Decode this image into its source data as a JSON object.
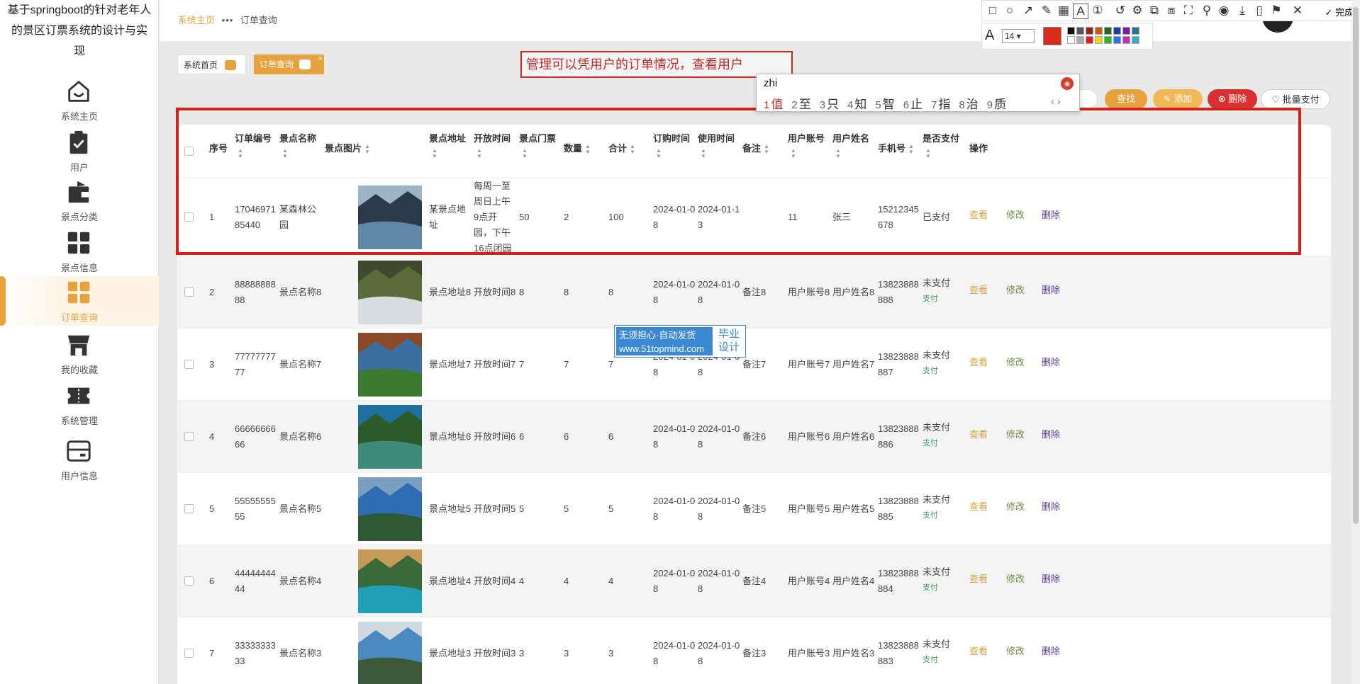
{
  "app_title": "基于springboot的针对老年人的景区订票系统的设计与实现",
  "nav": [
    {
      "label": "系统主页",
      "icon": "home-icon"
    },
    {
      "label": "用户",
      "icon": "clipboard-check-icon"
    },
    {
      "label": "景点分类",
      "icon": "wallet-icon"
    },
    {
      "label": "景点信息",
      "icon": "grid-icon"
    },
    {
      "label": "订单查询",
      "icon": "grid-icon",
      "active": true
    },
    {
      "label": "我的收藏",
      "icon": "store-icon"
    },
    {
      "label": "系统管理",
      "icon": "ticket-icon"
    },
    {
      "label": "用户信息",
      "icon": "card-icon"
    }
  ],
  "breadcrumb": {
    "home": "系统主页",
    "sep": "•••",
    "current": "订单查询"
  },
  "tabs": [
    {
      "label": "系统首页"
    },
    {
      "label": "订单查询",
      "close": "×"
    }
  ],
  "annotation": {
    "text": "管理可以凭用户的订单情况，查看用户"
  },
  "ime": {
    "composition": "zhi",
    "candidates": [
      {
        "n": "1",
        "c": "值"
      },
      {
        "n": "2",
        "c": "至"
      },
      {
        "n": "3",
        "c": "只"
      },
      {
        "n": "4",
        "c": "知"
      },
      {
        "n": "5",
        "c": "智"
      },
      {
        "n": "6",
        "c": "止"
      },
      {
        "n": "7",
        "c": "指"
      },
      {
        "n": "8",
        "c": "治"
      },
      {
        "n": "9",
        "c": "质"
      }
    ],
    "nav": "‹  ›"
  },
  "toolbar": {
    "find": "查找",
    "add": "✎ 添加",
    "delete": "⊗ 删除",
    "batch_pay": "♡ 批量支付"
  },
  "columns": [
    "序号",
    "订单编号",
    "景点名称",
    "景点图片",
    "景点地址",
    "开放时间",
    "景点门票",
    "数量",
    "合计",
    "订购时间",
    "使用时间",
    "备注",
    "用户账号",
    "用户姓名",
    "手机号",
    "是否支付",
    "操作"
  ],
  "actions": {
    "view": "查看",
    "edit": "修改",
    "delete": "删除",
    "pay": "支付"
  },
  "rows": [
    {
      "idx": "1",
      "order_no": "1704697185440",
      "name": "某森林公园",
      "addr": "某景点地址",
      "open": "每周一至周日上午9点开园，下午16点闭园",
      "price": "50",
      "qty": "2",
      "total": "100",
      "order_time": "2024-01-08",
      "use_time": "2024-01-13",
      "note": "",
      "account": "11",
      "username": "张三",
      "phone": "15212345678",
      "paid": "已支付",
      "show_pay": false,
      "photo": [
        "#2b3a4a",
        "#5f88a8",
        "#9bb4c8"
      ]
    },
    {
      "idx": "2",
      "order_no": "8888888888",
      "name": "景点名称8",
      "addr": "景点地址8",
      "open": "开放时间8",
      "price": "8",
      "qty": "8",
      "total": "8",
      "order_time": "2024-01-08",
      "use_time": "2024-01-08",
      "note": "备注8",
      "account": "用户账号8",
      "username": "用户姓名8",
      "phone": "13823888888",
      "paid": "未支付",
      "show_pay": true,
      "photo": [
        "#5a6b3a",
        "#d8dde0",
        "#3f4a2c"
      ]
    },
    {
      "idx": "3",
      "order_no": "7777777777",
      "name": "景点名称7",
      "addr": "景点地址7",
      "open": "开放时间7",
      "price": "7",
      "qty": "7",
      "total": "7",
      "order_time": "2024-01-08",
      "use_time": "2024-01-08",
      "note": "备注7",
      "account": "用户账号7",
      "username": "用户姓名7",
      "phone": "13823888887",
      "paid": "未支付",
      "show_pay": true,
      "photo": [
        "#3a6fa0",
        "#3c7a2e",
        "#8a4a2a"
      ]
    },
    {
      "idx": "4",
      "order_no": "6666666666",
      "name": "景点名称6",
      "addr": "景点地址6",
      "open": "开放时间6",
      "price": "6",
      "qty": "6",
      "total": "6",
      "order_time": "2024-01-08",
      "use_time": "2024-01-08",
      "note": "备注6",
      "account": "用户账号6",
      "username": "用户姓名6",
      "phone": "13823888886",
      "paid": "未支付",
      "show_pay": true,
      "photo": [
        "#2c5a2a",
        "#3f8a7a",
        "#1f6fa0"
      ]
    },
    {
      "idx": "5",
      "order_no": "5555555555",
      "name": "景点名称5",
      "addr": "景点地址5",
      "open": "开放时间5",
      "price": "5",
      "qty": "5",
      "total": "5",
      "order_time": "2024-01-08",
      "use_time": "2024-01-08",
      "note": "备注5",
      "account": "用户账号5",
      "username": "用户姓名5",
      "phone": "13823888885",
      "paid": "未支付",
      "show_pay": true,
      "photo": [
        "#2f6db0",
        "#2d5a32",
        "#7a9fc0"
      ]
    },
    {
      "idx": "6",
      "order_no": "4444444444",
      "name": "景点名称4",
      "addr": "景点地址4",
      "open": "开放时间4",
      "price": "4",
      "qty": "4",
      "total": "4",
      "order_time": "2024-01-08",
      "use_time": "2024-01-08",
      "note": "备注4",
      "account": "用户账号4",
      "username": "用户姓名4",
      "phone": "13823888884",
      "paid": "未支付",
      "show_pay": true,
      "photo": [
        "#3a6a3a",
        "#1fa0b8",
        "#c89a5a"
      ]
    },
    {
      "idx": "7",
      "order_no": "3333333333",
      "name": "景点名称3",
      "addr": "景点地址3",
      "open": "开放时间3",
      "price": "3",
      "qty": "3",
      "total": "3",
      "order_time": "2024-01-08",
      "use_time": "2024-01-08",
      "note": "备注3",
      "account": "用户账号3",
      "username": "用户姓名3",
      "phone": "13823888883",
      "paid": "未支付",
      "show_pay": true,
      "photo": [
        "#4a8ac0",
        "#3a5a3a",
        "#d0d8e0"
      ]
    }
  ],
  "watermark": {
    "line1": "无须担心·自动发货",
    "line2": "www.51topmind.com",
    "right1": "毕业",
    "right2": "设计"
  },
  "shot_toolbar": {
    "done": "✓ 完成",
    "font_size": "14",
    "font_icon": "A",
    "main_color": "#d92c1c"
  }
}
